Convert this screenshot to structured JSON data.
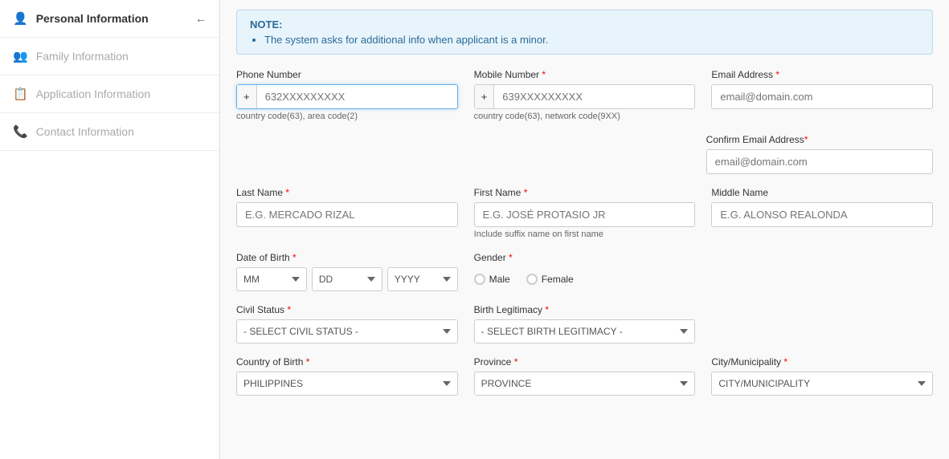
{
  "sidebar": {
    "items": [
      {
        "id": "personal-information",
        "label": "Personal Information",
        "icon": "👤",
        "active": true,
        "showArrow": true
      },
      {
        "id": "family-information",
        "label": "Family Information",
        "icon": "👥",
        "active": false,
        "showArrow": false
      },
      {
        "id": "application-information",
        "label": "Application Information",
        "icon": "📋",
        "active": false,
        "showArrow": false
      },
      {
        "id": "contact-information",
        "label": "Contact Information",
        "icon": "📞",
        "active": false,
        "showArrow": false
      }
    ]
  },
  "note": {
    "title": "NOTE:",
    "bullet": "The system asks for additional info when applicant is a minor."
  },
  "form": {
    "phone_number": {
      "label": "Phone Number",
      "required": false,
      "prefix": "+",
      "placeholder": "632XXXXXXXXX",
      "hint": "country code(63), area code(2)"
    },
    "mobile_number": {
      "label": "Mobile Number",
      "required": true,
      "prefix": "+",
      "placeholder": "639XXXXXXXXX",
      "hint": "country code(63), network code(9XX)"
    },
    "email_address": {
      "label": "Email Address",
      "required": true,
      "placeholder": "email@domain.com"
    },
    "confirm_email": {
      "label": "Confirm Email Address",
      "required": true,
      "placeholder": "email@domain.com"
    },
    "last_name": {
      "label": "Last Name",
      "required": true,
      "placeholder": "E.G. MERCADO RIZAL"
    },
    "first_name": {
      "label": "First Name",
      "required": true,
      "placeholder": "E.G. JOSÉ PROTASIO JR",
      "hint": "Include suffix name on first name"
    },
    "middle_name": {
      "label": "Middle Name",
      "required": false,
      "placeholder": "E.G. ALONSO REALONDA"
    },
    "date_of_birth": {
      "label": "Date of Birth",
      "required": true,
      "month_options": [
        "MM"
      ],
      "day_options": [
        "DD"
      ],
      "year_options": [
        "YYYY"
      ]
    },
    "gender": {
      "label": "Gender",
      "required": true,
      "options": [
        "Male",
        "Female"
      ]
    },
    "civil_status": {
      "label": "Civil Status",
      "required": true,
      "placeholder": "- SELECT CIVIL STATUS -"
    },
    "birth_legitimacy": {
      "label": "Birth Legitimacy",
      "required": true,
      "placeholder": "- SELECT BIRTH LEGITIMACY -"
    },
    "country_of_birth": {
      "label": "Country of Birth",
      "required": true,
      "placeholder": "PHILIPPINES"
    },
    "province": {
      "label": "Province",
      "required": true,
      "placeholder": "PROVINCE"
    },
    "city_municipality": {
      "label": "City/Municipality",
      "required": true,
      "placeholder": "CITY/MUNICIPALITY"
    }
  }
}
